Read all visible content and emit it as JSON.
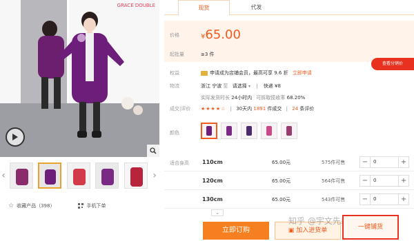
{
  "left": {
    "photo_badge": "GRACE DOUBLE",
    "favorite_label": "收藏产品（398）",
    "mobile_order_label": "手机下单"
  },
  "tabs": [
    {
      "label": "现货",
      "active": true
    },
    {
      "label": "代发",
      "active": false
    }
  ],
  "price": {
    "label": "价格",
    "currency": "¥",
    "value": "65.00",
    "moq_label": "起批量",
    "moq_value": "≥3 件"
  },
  "float_button": "查看分销价",
  "rights": {
    "label": "权益",
    "text": "申请成为店铺会员，最高可享 9.6 折",
    "link": "立即申请"
  },
  "logistics": {
    "label": "物流",
    "from": "浙江 宁波",
    "to_label": "至",
    "to_value": "请选择",
    "express": "快递 ¥8",
    "ship_text_a": "实际发货时长",
    "ship_text_b": "24小时内",
    "ship_text_c": "可拆取揽收率",
    "ship_rate": "68.20%"
  },
  "reviews": {
    "label": "成交|评价",
    "stars": "★★★★☆",
    "deal_a": "30天内",
    "deal_b": "1891",
    "deal_c": "件成交",
    "count_a": "24",
    "count_b": "条评价"
  },
  "colors": {
    "label": "颜色",
    "count": 5
  },
  "sizes": {
    "label": "适合身高",
    "rows": [
      {
        "size": "110cm",
        "price": "65.00元",
        "stock": "575件可售",
        "qty": "0"
      },
      {
        "size": "120cm",
        "price": "65.00元",
        "stock": "564件可售",
        "qty": "0"
      },
      {
        "size": "130cm",
        "price": "65.00元",
        "stock": "543件可售",
        "qty": "0"
      }
    ]
  },
  "buttons": {
    "buy": "立即订购",
    "cart": "加入进货单",
    "distribute": "一键铺货"
  },
  "watermark": "知乎 @宇文先森",
  "colors_theme": {
    "accent": "#f35a1d",
    "buy_bg": "#f6801f",
    "price_bg": "#fff3ea",
    "red": "#e8321f"
  }
}
